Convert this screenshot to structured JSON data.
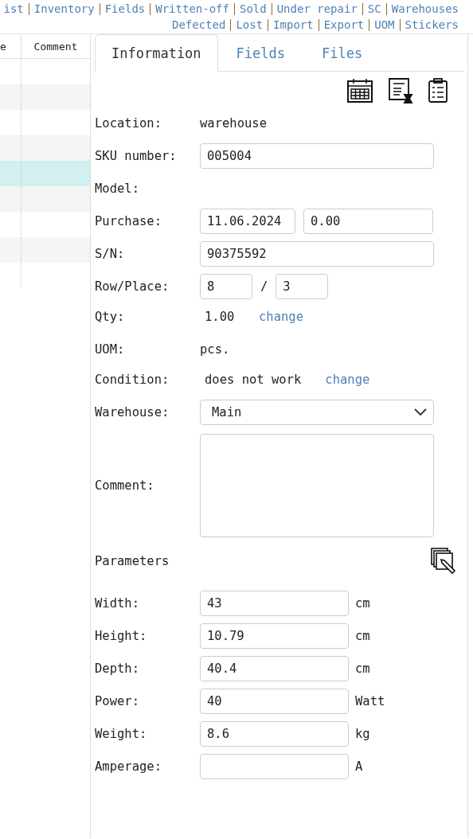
{
  "nav_links": [
    [
      "ist",
      "Inventory",
      "Fields",
      "Written-off",
      "Sold",
      "Under repair",
      "SC",
      "Warehouses"
    ],
    [
      "Defected",
      "Lost",
      "Import",
      "Export",
      "UOM",
      "Stickers"
    ]
  ],
  "table": {
    "columns": [
      "e",
      "Comment"
    ],
    "rows": [
      {
        "selected": false
      },
      {
        "selected": false
      },
      {
        "selected": false
      },
      {
        "selected": false
      },
      {
        "selected": true
      },
      {
        "selected": false
      },
      {
        "selected": false
      },
      {
        "selected": false
      },
      {
        "selected": false
      }
    ]
  },
  "tabs": [
    {
      "label": "Information",
      "selected": true
    },
    {
      "label": "Fields",
      "selected": false
    },
    {
      "label": "Files",
      "selected": false
    }
  ],
  "info": [
    {
      "kind": "text",
      "label": "Location:",
      "value": "warehouse"
    },
    {
      "kind": "input",
      "label": "SKU number:",
      "value": "005004"
    },
    {
      "kind": "text",
      "label": "Model:"
    },
    {
      "kind": "pair",
      "label": "Purchase:",
      "value": "11.06.2024",
      "value2": "0.00"
    },
    {
      "kind": "input",
      "label": "S/N:",
      "value": "90375592"
    },
    {
      "kind": "place",
      "label": "Row/Place:",
      "value": "8",
      "sep": "/",
      "value2": "3"
    },
    {
      "kind": "change",
      "label": "Qty:",
      "value": "1.00",
      "link": "change"
    },
    {
      "kind": "text",
      "label": "UOM:",
      "value": "pcs."
    },
    {
      "kind": "change",
      "label": "Condition:",
      "value": "does not work",
      "link": "change"
    },
    {
      "kind": "select",
      "label": "Warehouse:",
      "value": "Main"
    },
    {
      "kind": "textarea",
      "label": "Comment:"
    }
  ],
  "parameters": {
    "title": "Parameters",
    "rows": [
      {
        "label": "Width:",
        "value": "43",
        "unit": "cm"
      },
      {
        "label": "Height:",
        "value": "10.79",
        "unit": "cm"
      },
      {
        "label": "Depth:",
        "value": "40.4",
        "unit": "cm"
      },
      {
        "label": "Power:",
        "value": "40",
        "unit": "Watt"
      },
      {
        "label": "Weight:",
        "value": "8.6",
        "unit": "kg"
      },
      {
        "label": "Amperage:",
        "unit": "A"
      }
    ]
  }
}
